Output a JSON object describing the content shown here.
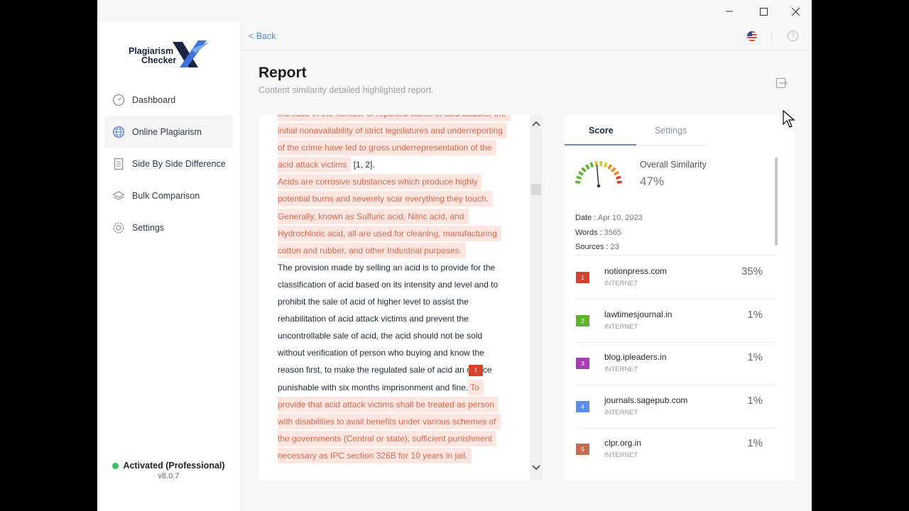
{
  "window": {
    "controls": [
      "minimize-icon",
      "maximize-icon",
      "close-icon"
    ]
  },
  "logo": {
    "line1": "Plagiarism",
    "line2": "Checker",
    "mark": "X"
  },
  "sidebar": {
    "items": [
      {
        "label": "Dashboard",
        "icon": "dashboard-icon"
      },
      {
        "label": "Online Plagiarism",
        "icon": "globe-icon",
        "active": true
      },
      {
        "label": "Side By Side Difference",
        "icon": "document-icon"
      },
      {
        "label": "Bulk Comparison",
        "icon": "layers-icon"
      },
      {
        "label": "Settings",
        "icon": "gear-icon"
      }
    ],
    "status": "Activated (Professional)",
    "version": "v8.0.7"
  },
  "topbar": {
    "back_label": "< Back",
    "flag": "us-flag-icon",
    "help": "?"
  },
  "report": {
    "title": "Report",
    "subtitle": "Content similarity detailed highlighted report."
  },
  "text_lines": [
    {
      "text": "increase in the number of reported cases of acid attacks, the",
      "hl": true
    },
    {
      "text": "initial nonavailability of strict legislatures and underreporting",
      "hl": true
    },
    {
      "text": "of the crime have led to gross underrepresentation of the",
      "hl": true
    },
    {
      "text": "acid attack victims",
      "hl": true,
      "tail": " [1, 2]."
    },
    {
      "text": "Acids are corrosive substances which produce highly",
      "hl": true
    },
    {
      "text": "potential burns and severely scar everything they touch.",
      "hl": true
    },
    {
      "text": "Generally, known as Sulfuric acid, Nitric acid, and",
      "hl": true
    },
    {
      "text": "Hydrochloric acid, all are used for cleaning, manufacturing",
      "hl": true
    },
    {
      "text": "cotton and rubber, and other Industrial purposes.",
      "hl": true
    },
    {
      "text": "The provision made by selling an acid is to provide for the",
      "hl": false
    },
    {
      "text": "classification of acid based on its intensity and level and to",
      "hl": false
    },
    {
      "text": "prohibit the sale of acid of higher level to assist the",
      "hl": false
    },
    {
      "text": "rehabilitation of acid attack victims and prevent the",
      "hl": false
    },
    {
      "text": "uncontrollable sale of acid, the acid should not be sold",
      "hl": false
    },
    {
      "text": "without verification of person who buying and know the",
      "hl": false
    },
    {
      "text": "reason first, to make the regulated sale of acid an o",
      "hl": false,
      "badge": "1",
      "tail": "ce"
    },
    {
      "text": "punishable with six months imprisonment and fine.",
      "hl": false,
      "hltail": " To"
    },
    {
      "text": "provide that acid attack victims shall be treated as person",
      "hl": true
    },
    {
      "text": "with disabilities to avail benefits under various schemes of",
      "hl": true
    },
    {
      "text": "the governments (Central or state), sufficient punishment",
      "hl": true
    },
    {
      "text": "necessary as IPC section 326B for 10 years in jail.",
      "hl": true
    }
  ],
  "panel": {
    "tabs": {
      "score": "Score",
      "settings": "Settings"
    },
    "overall_label": "Overall Similarity",
    "overall_value": "47%",
    "overall_fraction": 0.47,
    "date_label": "Date :",
    "date_value": "Apr 10, 2023",
    "words_label": "Words :",
    "words_value": "3565",
    "sources_label": "Sources :",
    "sources_value": "23",
    "sources": [
      {
        "num": "1",
        "name": "notionpress.com",
        "kind": "INTERNET",
        "pct": "35%",
        "color": "#d9412f"
      },
      {
        "num": "2",
        "name": "lawtimesjournal.in",
        "kind": "INTERNET",
        "pct": "1%",
        "color": "#5fb52a"
      },
      {
        "num": "3",
        "name": "blog.ipleaders.in",
        "kind": "INTERNET",
        "pct": "1%",
        "color": "#a83cb3"
      },
      {
        "num": "4",
        "name": "journals.sagepub.com",
        "kind": "INTERNET",
        "pct": "1%",
        "color": "#5b8def"
      },
      {
        "num": "5",
        "name": "clpr.org.in",
        "kind": "INTERNET",
        "pct": "1%",
        "color": "#c86a4f"
      }
    ]
  }
}
